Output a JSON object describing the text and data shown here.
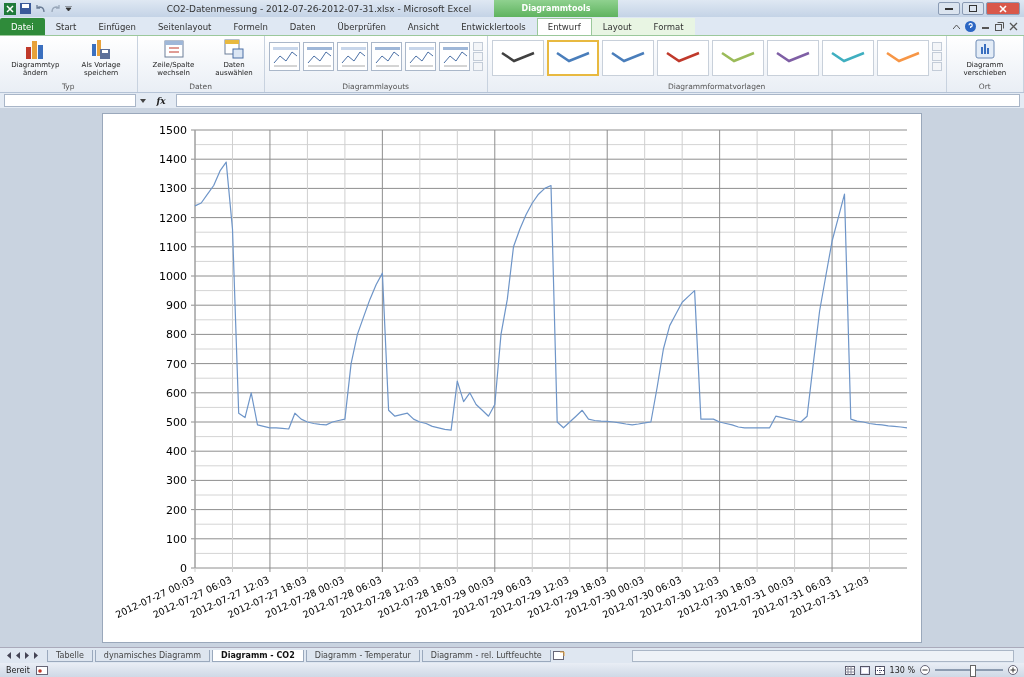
{
  "window": {
    "title": "CO2-Datenmessung - 2012-07-26-2012-07-31.xlsx - Microsoft Excel",
    "contextual_header": "Diagrammtools"
  },
  "ribbon_tabs": [
    {
      "label": "Datei",
      "kind": "file",
      "selected": false
    },
    {
      "label": "Start",
      "kind": "normal",
      "selected": false
    },
    {
      "label": "Einfügen",
      "kind": "normal",
      "selected": false
    },
    {
      "label": "Seitenlayout",
      "kind": "normal",
      "selected": false
    },
    {
      "label": "Formeln",
      "kind": "normal",
      "selected": false
    },
    {
      "label": "Daten",
      "kind": "normal",
      "selected": false
    },
    {
      "label": "Überprüfen",
      "kind": "normal",
      "selected": false
    },
    {
      "label": "Ansicht",
      "kind": "normal",
      "selected": false
    },
    {
      "label": "Entwicklertools",
      "kind": "normal",
      "selected": false
    },
    {
      "label": "Entwurf",
      "kind": "contextual",
      "selected": true
    },
    {
      "label": "Layout",
      "kind": "contextual",
      "selected": false
    },
    {
      "label": "Format",
      "kind": "contextual",
      "selected": false
    }
  ],
  "ribbon_groups": [
    {
      "label": "Typ",
      "kind": "buttons",
      "buttons": [
        {
          "label": "Diagrammtyp ändern"
        },
        {
          "label": "Als Vorlage speichern"
        }
      ]
    },
    {
      "label": "Daten",
      "kind": "buttons",
      "buttons": [
        {
          "label": "Zeile/Spalte wechseln"
        },
        {
          "label": "Daten auswählen"
        }
      ]
    },
    {
      "label": "Diagrammlayouts",
      "kind": "layouts"
    },
    {
      "label": "Diagrammformatvorlagen",
      "kind": "styles",
      "styles": [
        {
          "color": "#404040",
          "selected": false
        },
        {
          "color": "#4a7ebb",
          "selected": true
        },
        {
          "color": "#4a7ebb",
          "selected": false
        },
        {
          "color": "#c0392b",
          "selected": false
        },
        {
          "color": "#9bbb59",
          "selected": false
        },
        {
          "color": "#7f5fa5",
          "selected": false
        },
        {
          "color": "#3fafc0",
          "selected": false
        },
        {
          "color": "#f79646",
          "selected": false
        }
      ]
    },
    {
      "label": "Ort",
      "kind": "buttons",
      "buttons": [
        {
          "label": "Diagramm verschieben"
        }
      ]
    }
  ],
  "formula_bar": {
    "fx_label": "fx"
  },
  "chart": {
    "chart_data": {
      "type": "line",
      "grid": true,
      "ylim": [
        0,
        1500
      ],
      "yticks": [
        0,
        100,
        200,
        300,
        400,
        500,
        600,
        700,
        800,
        900,
        1000,
        1100,
        1200,
        1300,
        1400,
        1500
      ],
      "categories": [
        "2012-07-27 00:03",
        null,
        null,
        null,
        null,
        null,
        "2012-07-27 06:03",
        null,
        null,
        null,
        null,
        null,
        "2012-07-27 12:03",
        null,
        null,
        null,
        null,
        null,
        "2012-07-27 18:03",
        null,
        null,
        null,
        null,
        null,
        "2012-07-28 00:03",
        null,
        null,
        null,
        null,
        null,
        "2012-07-28 06:03",
        null,
        null,
        null,
        null,
        null,
        "2012-07-28 12:03",
        null,
        null,
        null,
        null,
        null,
        "2012-07-28 18:03",
        null,
        null,
        null,
        null,
        null,
        "2012-07-29 00:03",
        null,
        null,
        null,
        null,
        null,
        "2012-07-29 06:03",
        null,
        null,
        null,
        null,
        null,
        "2012-07-29 12:03",
        null,
        null,
        null,
        null,
        null,
        "2012-07-29 18:03",
        null,
        null,
        null,
        null,
        null,
        "2012-07-30 00:03",
        null,
        null,
        null,
        null,
        null,
        "2012-07-30 06:03",
        null,
        null,
        null,
        null,
        null,
        "2012-07-30 12:03",
        null,
        null,
        null,
        null,
        null,
        "2012-07-30 18:03",
        null,
        null,
        null,
        null,
        null,
        "2012-07-31 00:03",
        null,
        null,
        null,
        null,
        null,
        "2012-07-31 06:03",
        null,
        null,
        null,
        null,
        null,
        "2012-07-31 12:03",
        null,
        null,
        null,
        null,
        null,
        null
      ],
      "series": [
        {
          "color": "#6e95c8",
          "values": [
            1240,
            1250,
            1280,
            1310,
            1360,
            1390,
            1160,
            530,
            515,
            600,
            490,
            485,
            480,
            480,
            478,
            476,
            530,
            510,
            500,
            495,
            492,
            490,
            500,
            505,
            510,
            700,
            800,
            860,
            920,
            970,
            1010,
            540,
            520,
            525,
            530,
            510,
            500,
            495,
            485,
            480,
            475,
            472,
            640,
            570,
            600,
            560,
            540,
            520,
            560,
            800,
            920,
            1100,
            1160,
            1210,
            1250,
            1280,
            1300,
            1310,
            500,
            480,
            500,
            520,
            540,
            510,
            505,
            503,
            502,
            500,
            497,
            493,
            490,
            493,
            497,
            500,
            620,
            750,
            830,
            870,
            910,
            930,
            950,
            510,
            510,
            510,
            500,
            495,
            490,
            483,
            480,
            480,
            480,
            480,
            480,
            520,
            515,
            510,
            505,
            500,
            520,
            700,
            880,
            1000,
            1120,
            1200,
            1280,
            510,
            503,
            500,
            495,
            492,
            490,
            487,
            485,
            483,
            480
          ]
        }
      ]
    }
  },
  "sheet_tabs": [
    {
      "label": "Tabelle",
      "selected": false
    },
    {
      "label": "dynamisches Diagramm",
      "selected": false
    },
    {
      "label": "Diagramm - CO2",
      "selected": true
    },
    {
      "label": "Diagramm - Temperatur",
      "selected": false
    },
    {
      "label": "Diagramm - rel. Luftfeuchte",
      "selected": false
    }
  ],
  "status_bar": {
    "status": "Bereit",
    "zoom": "130 %",
    "zoom_level": {
      "level": 0.55
    }
  }
}
